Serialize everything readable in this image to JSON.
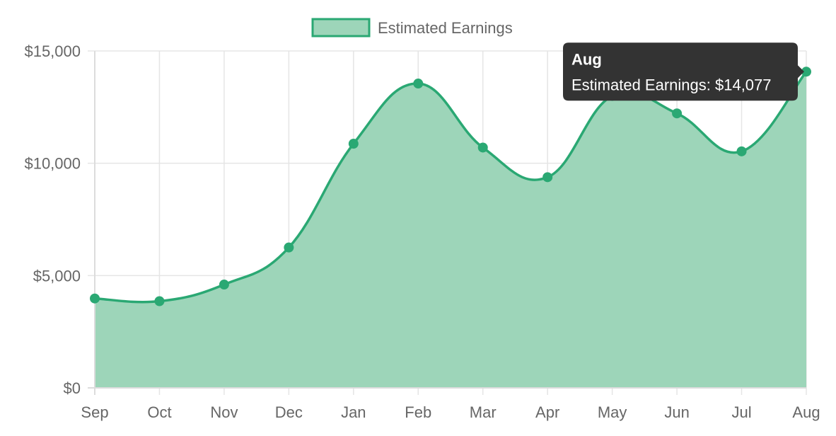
{
  "chart_data": {
    "type": "area",
    "categories": [
      "Sep",
      "Oct",
      "Nov",
      "Dec",
      "Jan",
      "Feb",
      "Mar",
      "Apr",
      "May",
      "Jun",
      "Jul",
      "Aug"
    ],
    "series": [
      {
        "name": "Estimated Earnings",
        "values": [
          3980,
          3860,
          4600,
          6250,
          10870,
          13550,
          10700,
          9380,
          13000,
          12220,
          10530,
          14077
        ]
      }
    ],
    "ylim": [
      0,
      15000
    ],
    "yticks": [
      0,
      5000,
      10000,
      15000
    ],
    "ytick_labels": [
      "$0",
      "$5,000",
      "$10,000",
      "$15,000"
    ],
    "grid": true,
    "legend_position": "top-center",
    "colors": {
      "line": "#2aa873",
      "fill": "#9dd5b9",
      "grid": "#e5e5e5",
      "axis": "#dcdcdc",
      "tooltip_bg": "#333333"
    },
    "tooltip": {
      "title": "Aug",
      "body": "Estimated Earnings: $14,077",
      "category_index": 11
    }
  }
}
